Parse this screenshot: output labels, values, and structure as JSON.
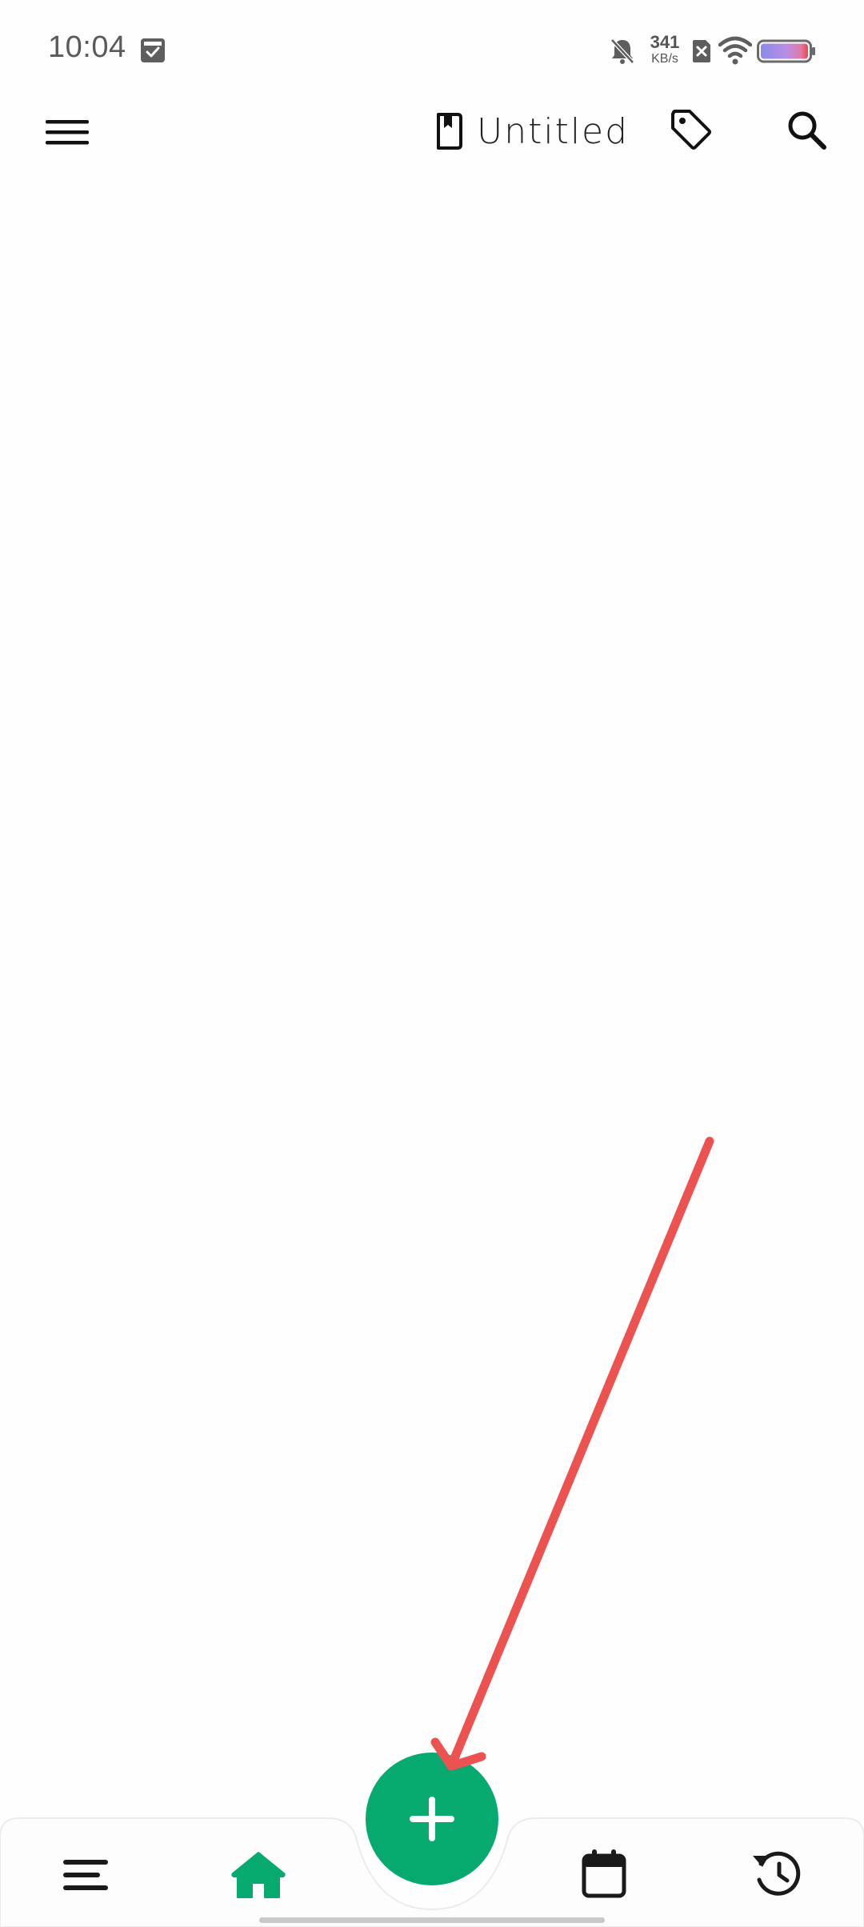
{
  "status_bar": {
    "time": "10:04",
    "net_speed_value": "341",
    "net_speed_unit": "KB/s"
  },
  "app_bar": {
    "notebook_title": "Untitled"
  },
  "icons": {
    "menu": "hamburger-menu-icon",
    "notebook": "bookmark-notebook-icon",
    "tag": "tag-icon",
    "search": "search-icon",
    "list": "list-icon",
    "home": "home-icon",
    "add": "plus-icon",
    "calendar": "calendar-icon",
    "history": "history-icon"
  },
  "colors": {
    "accent": "#06aa6e",
    "arrow": "#ec5350",
    "icon": "#1a1a1a"
  }
}
